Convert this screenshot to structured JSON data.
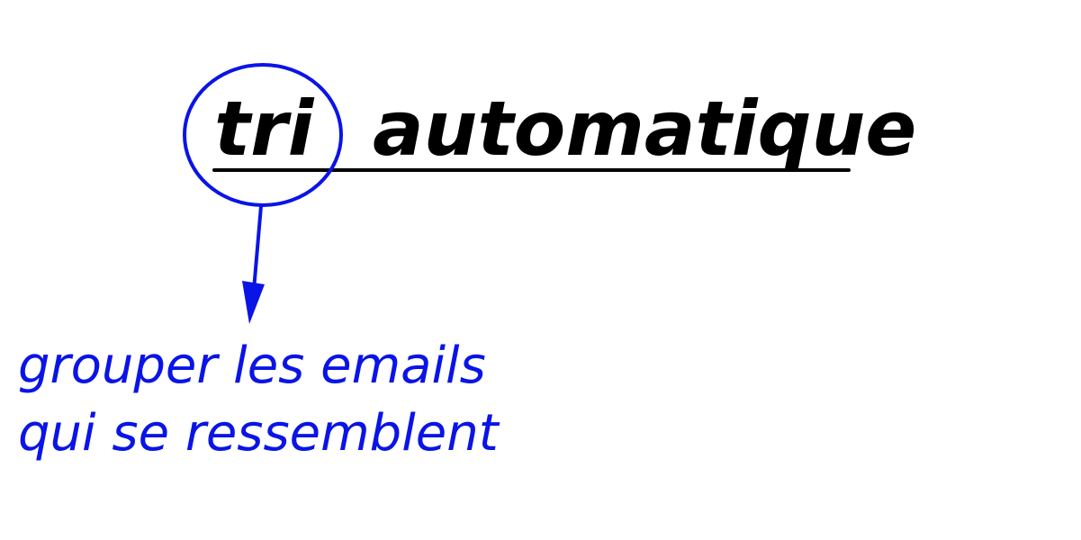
{
  "title": {
    "highlighted_word": "tri",
    "rest": "automatique",
    "text_color": "#000000"
  },
  "annotation": {
    "lines": [
      "grouper les emails",
      "qui se ressemblent"
    ],
    "color": "#0a14e6"
  }
}
